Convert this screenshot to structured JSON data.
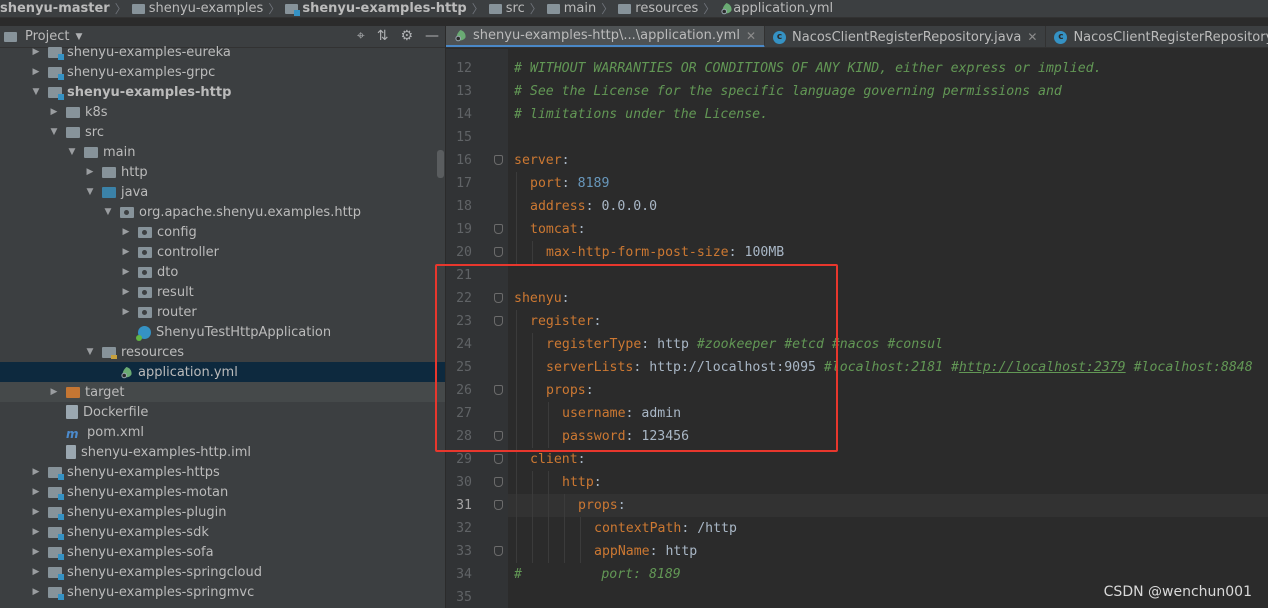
{
  "breadcrumbs": [
    "shenyu-master",
    "shenyu-examples",
    "shenyu-examples-http",
    "src",
    "main",
    "resources",
    "application.yml"
  ],
  "project": {
    "title": "Project",
    "tree": [
      {
        "label": "shenyu-examples-eureka",
        "indent": 1,
        "arrow": "right",
        "icon": "module"
      },
      {
        "label": "shenyu-examples-grpc",
        "indent": 1,
        "arrow": "right",
        "icon": "module"
      },
      {
        "label": "shenyu-examples-http",
        "indent": 1,
        "arrow": "down",
        "icon": "module",
        "bold": true
      },
      {
        "label": "k8s",
        "indent": 2,
        "arrow": "right",
        "icon": "folder"
      },
      {
        "label": "src",
        "indent": 2,
        "arrow": "down",
        "icon": "folder"
      },
      {
        "label": "main",
        "indent": 3,
        "arrow": "down",
        "icon": "folder"
      },
      {
        "label": "http",
        "indent": 4,
        "arrow": "right",
        "icon": "folder"
      },
      {
        "label": "java",
        "indent": 4,
        "arrow": "down",
        "icon": "src"
      },
      {
        "label": "org.apache.shenyu.examples.http",
        "indent": 5,
        "arrow": "down",
        "icon": "pkg"
      },
      {
        "label": "config",
        "indent": 6,
        "arrow": "right",
        "icon": "pkg"
      },
      {
        "label": "controller",
        "indent": 6,
        "arrow": "right",
        "icon": "pkg"
      },
      {
        "label": "dto",
        "indent": 6,
        "arrow": "right",
        "icon": "pkg"
      },
      {
        "label": "result",
        "indent": 6,
        "arrow": "right",
        "icon": "pkg"
      },
      {
        "label": "router",
        "indent": 6,
        "arrow": "right",
        "icon": "pkg"
      },
      {
        "label": "ShenyuTestHttpApplication",
        "indent": 6,
        "arrow": "none",
        "icon": "class"
      },
      {
        "label": "resources",
        "indent": 4,
        "arrow": "down",
        "icon": "res"
      },
      {
        "label": "application.yml",
        "indent": 5,
        "arrow": "none",
        "icon": "yml",
        "selected": true
      },
      {
        "label": "target",
        "indent": 2,
        "arrow": "right",
        "icon": "target",
        "dim": true
      },
      {
        "label": "Dockerfile",
        "indent": 2,
        "arrow": "none",
        "icon": "docker"
      },
      {
        "label": "pom.xml",
        "indent": 2,
        "arrow": "none",
        "icon": "pom"
      },
      {
        "label": "shenyu-examples-http.iml",
        "indent": 2,
        "arrow": "none",
        "icon": "iml"
      },
      {
        "label": "shenyu-examples-https",
        "indent": 1,
        "arrow": "right",
        "icon": "module"
      },
      {
        "label": "shenyu-examples-motan",
        "indent": 1,
        "arrow": "right",
        "icon": "module"
      },
      {
        "label": "shenyu-examples-plugin",
        "indent": 1,
        "arrow": "right",
        "icon": "module"
      },
      {
        "label": "shenyu-examples-sdk",
        "indent": 1,
        "arrow": "right",
        "icon": "module"
      },
      {
        "label": "shenyu-examples-sofa",
        "indent": 1,
        "arrow": "right",
        "icon": "module"
      },
      {
        "label": "shenyu-examples-springcloud",
        "indent": 1,
        "arrow": "right",
        "icon": "module"
      },
      {
        "label": "shenyu-examples-springmvc",
        "indent": 1,
        "arrow": "right",
        "icon": "module"
      }
    ]
  },
  "tabs": [
    {
      "label": "shenyu-examples-http\\...\\application.yml",
      "icon": "yml",
      "active": true
    },
    {
      "label": "NacosClientRegisterRepository.java",
      "icon": "class"
    },
    {
      "label": "NacosClientRegisterRepositoryTest.java",
      "icon": "class"
    }
  ],
  "editor": {
    "current_line": "31",
    "lines": [
      {
        "n": "12",
        "indent": 0,
        "fold": false,
        "parts": [
          {
            "t": "# WITHOUT WARRANTIES OR CONDITIONS OF ANY KIND, either express or implied.",
            "c": "c"
          }
        ]
      },
      {
        "n": "13",
        "indent": 0,
        "fold": false,
        "parts": [
          {
            "t": "# See the License for the specific language governing permissions and",
            "c": "c"
          }
        ]
      },
      {
        "n": "14",
        "indent": 0,
        "fold": false,
        "parts": [
          {
            "t": "# limitations under the License.",
            "c": "c"
          }
        ]
      },
      {
        "n": "15",
        "indent": 0,
        "fold": false,
        "parts": []
      },
      {
        "n": "16",
        "indent": 0,
        "fold": true,
        "parts": [
          {
            "t": "server",
            "c": "k"
          },
          {
            "t": ":",
            "c": "v"
          }
        ]
      },
      {
        "n": "17",
        "indent": 1,
        "fold": false,
        "parts": [
          {
            "t": "port",
            "c": "k"
          },
          {
            "t": ": ",
            "c": "v"
          },
          {
            "t": "8189",
            "c": "n"
          }
        ]
      },
      {
        "n": "18",
        "indent": 1,
        "fold": false,
        "parts": [
          {
            "t": "address",
            "c": "k"
          },
          {
            "t": ": 0.0.0.0",
            "c": "v"
          }
        ]
      },
      {
        "n": "19",
        "indent": 1,
        "fold": true,
        "parts": [
          {
            "t": "tomcat",
            "c": "k"
          },
          {
            "t": ":",
            "c": "v"
          }
        ]
      },
      {
        "n": "20",
        "indent": 2,
        "fold": true,
        "parts": [
          {
            "t": "max-http-form-post-size",
            "c": "k"
          },
          {
            "t": ": 100MB",
            "c": "v"
          }
        ]
      },
      {
        "n": "21",
        "indent": 0,
        "fold": false,
        "parts": []
      },
      {
        "n": "22",
        "indent": 0,
        "fold": true,
        "parts": [
          {
            "t": "shenyu",
            "c": "k"
          },
          {
            "t": ":",
            "c": "v"
          }
        ]
      },
      {
        "n": "23",
        "indent": 1,
        "fold": true,
        "parts": [
          {
            "t": "register",
            "c": "k"
          },
          {
            "t": ":",
            "c": "v"
          }
        ]
      },
      {
        "n": "24",
        "indent": 2,
        "fold": false,
        "parts": [
          {
            "t": "registerType",
            "c": "k"
          },
          {
            "t": ": http ",
            "c": "v"
          },
          {
            "t": "#zookeeper #etcd #nacos #consul",
            "c": "c"
          }
        ]
      },
      {
        "n": "25",
        "indent": 2,
        "fold": false,
        "parts": [
          {
            "t": "serverLists",
            "c": "k"
          },
          {
            "t": ": http://localhost:9095 ",
            "c": "v"
          },
          {
            "t": "#localhost:2181 #",
            "c": "c"
          },
          {
            "t": "http://localhost:2379",
            "c": "c u"
          },
          {
            "t": " #localhost:8848",
            "c": "c"
          }
        ]
      },
      {
        "n": "26",
        "indent": 2,
        "fold": true,
        "parts": [
          {
            "t": "props",
            "c": "k"
          },
          {
            "t": ":",
            "c": "v"
          }
        ]
      },
      {
        "n": "27",
        "indent": 3,
        "fold": false,
        "parts": [
          {
            "t": "username",
            "c": "k"
          },
          {
            "t": ": admin",
            "c": "v"
          }
        ]
      },
      {
        "n": "28",
        "indent": 3,
        "fold": true,
        "parts": [
          {
            "t": "password",
            "c": "k"
          },
          {
            "t": ": 123456",
            "c": "v"
          }
        ]
      },
      {
        "n": "29",
        "indent": 1,
        "fold": true,
        "parts": [
          {
            "t": "client",
            "c": "k"
          },
          {
            "t": ":",
            "c": "v"
          }
        ]
      },
      {
        "n": "30",
        "indent": 3,
        "fold": true,
        "parts": [
          {
            "t": "http",
            "c": "k"
          },
          {
            "t": ":",
            "c": "v"
          }
        ]
      },
      {
        "n": "31",
        "indent": 4,
        "fold": true,
        "parts": [
          {
            "t": "props",
            "c": "k"
          },
          {
            "t": ":",
            "c": "v"
          }
        ]
      },
      {
        "n": "32",
        "indent": 5,
        "fold": false,
        "parts": [
          {
            "t": "contextPath",
            "c": "k"
          },
          {
            "t": ": /http",
            "c": "v"
          }
        ]
      },
      {
        "n": "33",
        "indent": 5,
        "fold": true,
        "parts": [
          {
            "t": "appName",
            "c": "k"
          },
          {
            "t": ": http",
            "c": "v"
          }
        ]
      },
      {
        "n": "34",
        "indent": 0,
        "fold": false,
        "parts": [
          {
            "t": "#          port: 8189",
            "c": "c"
          }
        ]
      },
      {
        "n": "35",
        "indent": 0,
        "fold": false,
        "parts": []
      }
    ]
  },
  "watermark": "CSDN @wenchun001"
}
